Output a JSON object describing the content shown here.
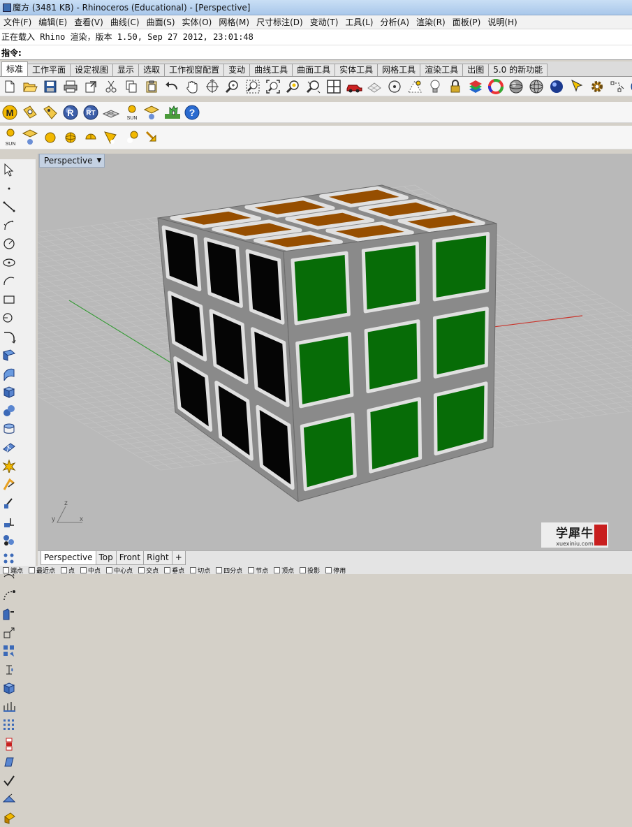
{
  "window": {
    "title": "魔方 (3481 KB) - Rhinoceros (Educational) - [Perspective]"
  },
  "menu": [
    "文件(F)",
    "编辑(E)",
    "查看(V)",
    "曲线(C)",
    "曲面(S)",
    "实体(O)",
    "网格(M)",
    "尺寸标注(D)",
    "变动(T)",
    "工具(L)",
    "分析(A)",
    "渲染(R)",
    "面板(P)",
    "说明(H)"
  ],
  "command": {
    "history": "正在载入 Rhino 渲染，版本 1.50, Sep 27 2012, 23:01:48",
    "prompt": "指令:",
    "value": ""
  },
  "toolbar_tabs": [
    "标准",
    "工作平面",
    "设定视图",
    "显示",
    "选取",
    "工作视窗配置",
    "变动",
    "曲线工具",
    "曲面工具",
    "实体工具",
    "网格工具",
    "渲染工具",
    "出图",
    "5.0 的新功能"
  ],
  "toolbar_tabs_active": "标准",
  "toolbar_row1_icons": [
    "new-icon",
    "open-icon",
    "save-icon",
    "print-icon",
    "export-icon",
    "cut-icon",
    "copy-icon",
    "paste-icon",
    "undo-icon",
    "pan-icon",
    "rotate-view-icon",
    "zoom-icon",
    "zoom-window-icon",
    "zoom-extents-icon",
    "zoom-selected-icon",
    "zoom-dynamic-icon",
    "four-viewports-icon",
    "car-icon",
    "render-mesh-icon",
    "circle-icon",
    "point-icon",
    "light-icon",
    "lock-icon",
    "layer-icon",
    "color-wheel-icon",
    "shaded-sphere-icon",
    "wire-sphere-icon",
    "rendered-sphere-icon",
    "select-icon",
    "options-gear-icon",
    "snap-icon",
    "help-icon"
  ],
  "toolbar_row2_icons": [
    {
      "name": "material-m-icon",
      "label": "M"
    },
    {
      "name": "camera-icon",
      "label": ""
    },
    {
      "name": "tag-icon",
      "label": ""
    },
    {
      "name": "render-r-icon",
      "label": "R"
    },
    {
      "name": "rt-icon",
      "label": "RT"
    },
    {
      "name": "ground-plane-icon",
      "label": ""
    },
    {
      "name": "sun-icon",
      "label": "SUN"
    },
    {
      "name": "environment-icon",
      "label": ""
    },
    {
      "name": "plant-icon",
      "label": ""
    },
    {
      "name": "help-icon",
      "label": "?"
    }
  ],
  "toolbar_row3_icons": [
    {
      "name": "sun-icon",
      "label": "SUN"
    },
    {
      "name": "spotlight-icon",
      "label": ""
    },
    {
      "name": "point-light-icon",
      "label": ""
    },
    {
      "name": "sphere-light-icon",
      "label": ""
    },
    {
      "name": "half-sphere-light-icon",
      "label": ""
    },
    {
      "name": "spot-light-cone-icon",
      "label": ""
    },
    {
      "name": "linear-light-icon",
      "label": ""
    },
    {
      "name": "directional-light-icon",
      "label": ""
    }
  ],
  "left_toolbar_icons": [
    "select-arrow-icon",
    "point-icon",
    "line-icon",
    "rectangle-icon",
    "circle-icon",
    "ellipse-icon",
    "arc-icon",
    "polygon-icon",
    "curve-icon",
    "fillet-icon",
    "surface-icon",
    "rail-icon",
    "box-icon",
    "sphere-icon",
    "cylinder-icon",
    "mesh-icon",
    "explode-icon",
    "boolean-icon",
    "trim-icon",
    "split-icon",
    "group-icon",
    "points-icon",
    "offset-icon",
    "sweep-icon",
    "extrude-icon",
    "scale-icon",
    "array-icon",
    "rotate-icon",
    "cube-solid-icon",
    "dimension-icon",
    "grid-points-icon",
    "block-icon",
    "cylinder-tool-icon",
    "check-icon",
    "cap-icon",
    "shell-icon"
  ],
  "viewport": {
    "label": "Perspective",
    "axis_z": "z",
    "axis_y": "y",
    "axis_x": "x"
  },
  "viewport_tabs": [
    "Perspective",
    "Top",
    "Front",
    "Right",
    "+"
  ],
  "viewport_tabs_active": "Perspective",
  "osnaps": [
    "端点",
    "最近点",
    "点",
    "中点",
    "中心点",
    "交点",
    "垂点",
    "切点",
    "四分点",
    "节点",
    "顶点",
    "投影",
    "停用"
  ],
  "watermark": {
    "main": "学犀牛",
    "sub": "xuexiniu.com",
    "seal": "中文网"
  },
  "colors": {
    "top_face": "#964e00",
    "front_face": "#076c07",
    "left_face": "#050505",
    "frame": "#e0e0e0",
    "viewport_bg": "#b9b9b9",
    "grid_line": "#c3c3c3",
    "x_axis": "#c8332a",
    "y_axis": "#3a9a3a"
  }
}
